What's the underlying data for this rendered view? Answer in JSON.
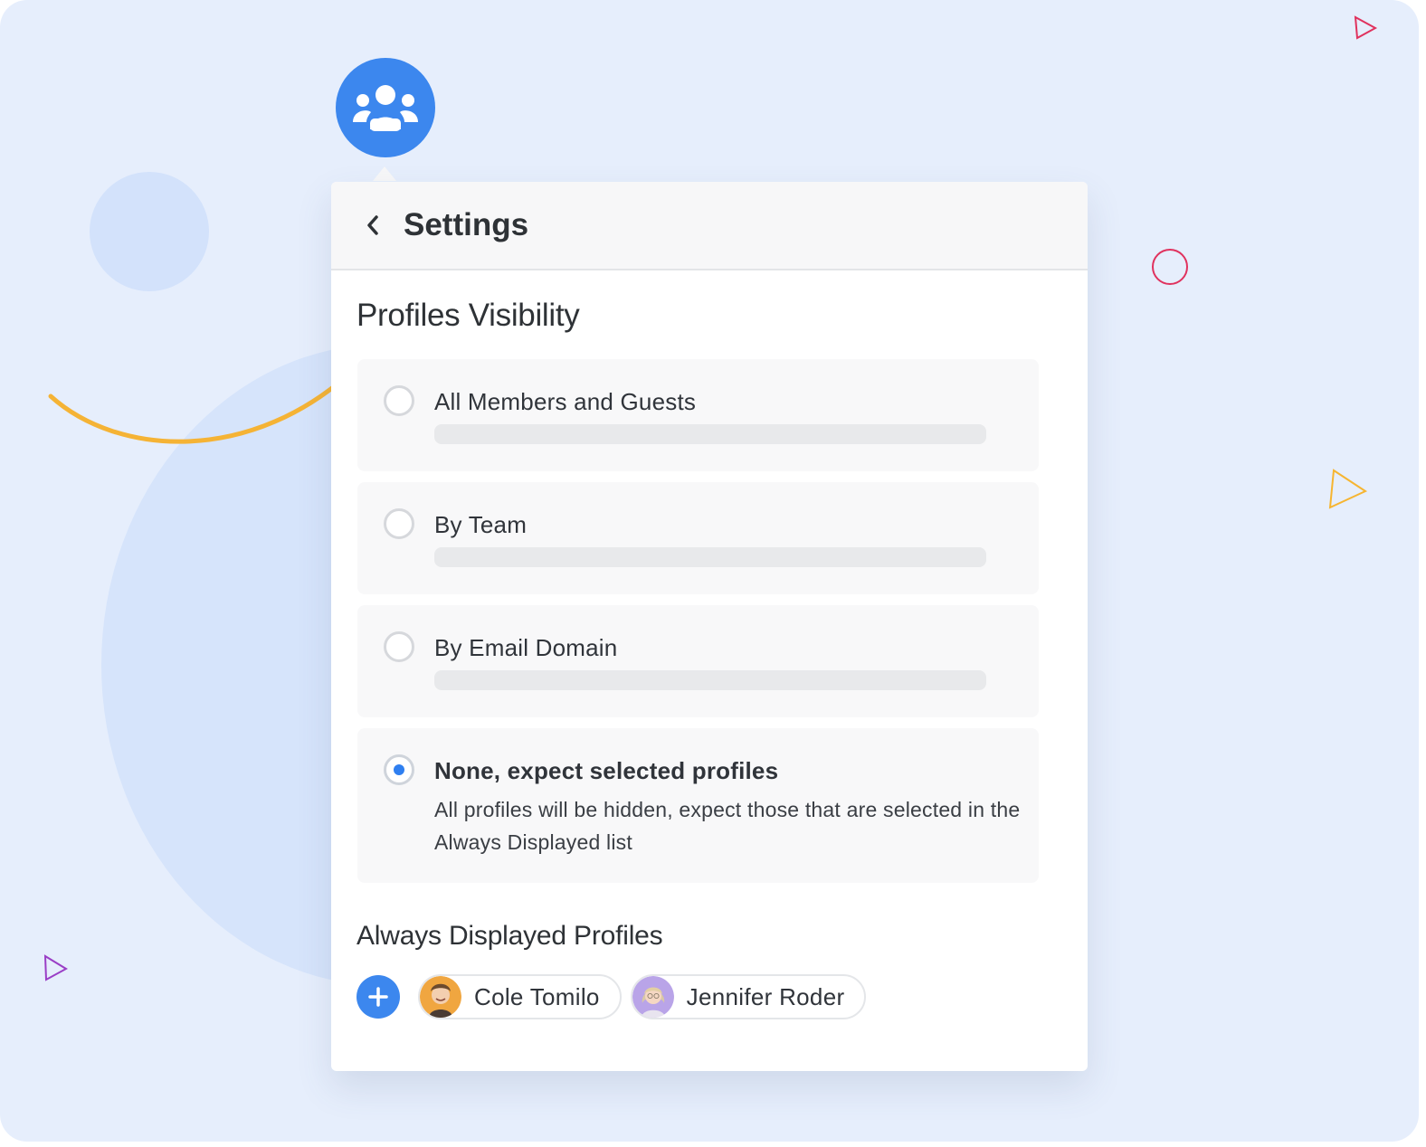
{
  "header": {
    "title": "Settings",
    "back_icon": "chevron-left-icon"
  },
  "badge": {
    "icon": "users-group-icon",
    "color": "#3c87ee"
  },
  "profiles_visibility": {
    "title": "Profiles Visibility",
    "options": [
      {
        "label": "All Members and Guests",
        "selected": false
      },
      {
        "label": "By Team",
        "selected": false
      },
      {
        "label": "By Email Domain",
        "selected": false
      },
      {
        "label": "None, expect selected profiles",
        "description": "All profiles will be hidden, expect those that are selected in the Always Displayed list",
        "selected": true
      }
    ]
  },
  "always_displayed": {
    "title": "Always Displayed Profiles",
    "add_icon": "plus-icon",
    "profiles": [
      {
        "name": "Cole Tomilo",
        "avatar_color": "#f0a640"
      },
      {
        "name": "Jennifer Roder",
        "avatar_color": "#b9a4e8"
      }
    ]
  },
  "colors": {
    "background": "#e6eefc",
    "accent": "#3c87ee",
    "arrow": "#f5b335",
    "deco_red": "#e0325e",
    "deco_orange": "#f6b531",
    "deco_purple": "#9a3ec6"
  }
}
